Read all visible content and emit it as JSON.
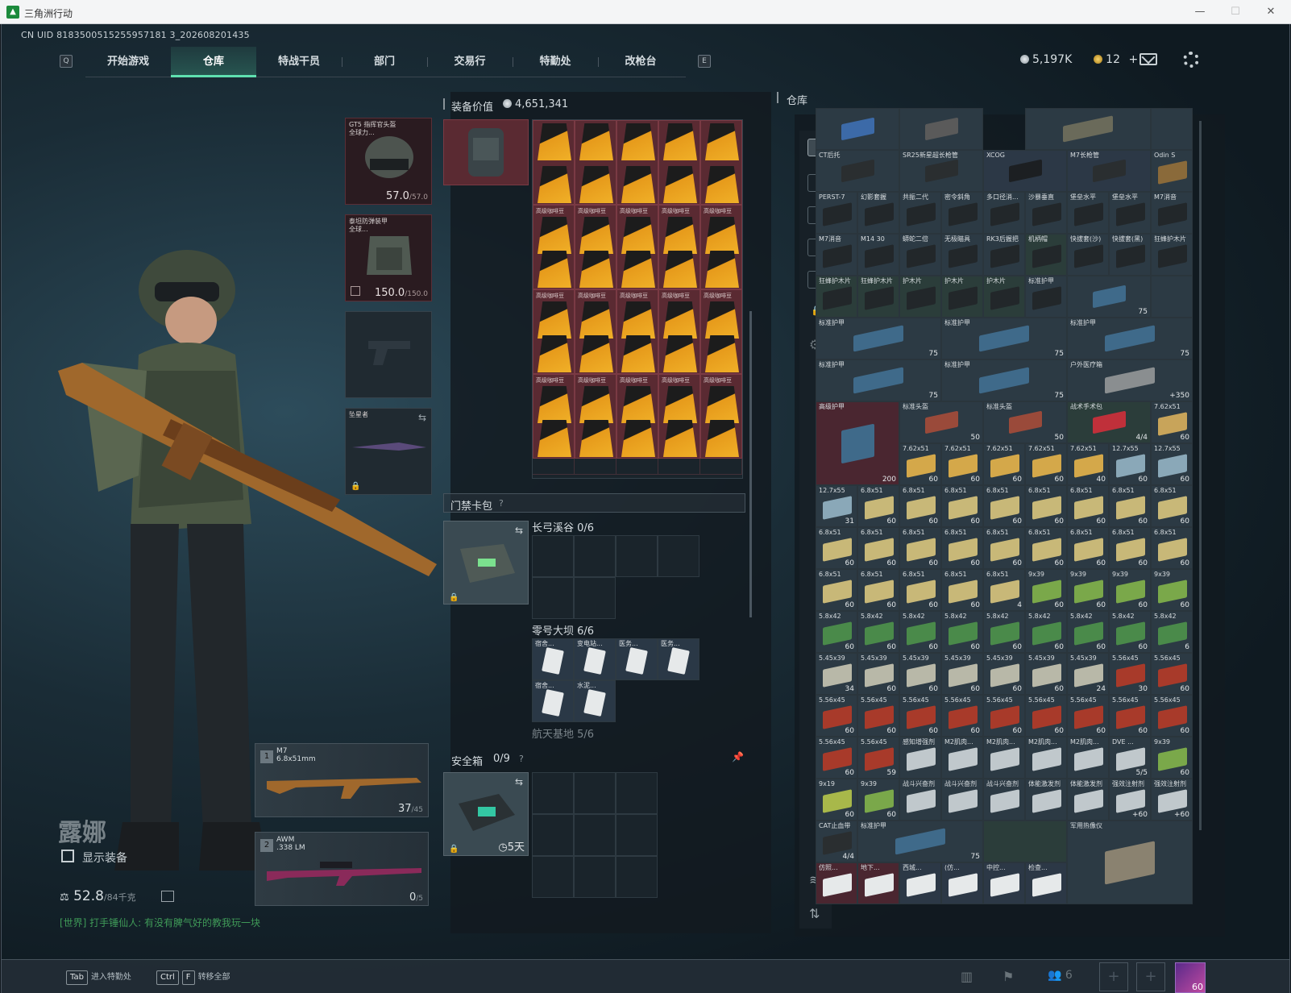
{
  "window": {
    "title": "三角洲行动",
    "minimize": "—",
    "maximize": "☐",
    "close": "✕"
  },
  "uid": "CN UID 8183500515255957181 3_202608201435",
  "nav": {
    "left_key": "Q",
    "right_key": "E",
    "tabs": [
      "开始游戏",
      "仓库",
      "特战干员",
      "部门",
      "交易行",
      "特勤处",
      "改枪台"
    ],
    "active": "仓库"
  },
  "currency": {
    "coins": "5,197K",
    "tickets": "12",
    "plus": "+"
  },
  "operator": {
    "name": "露娜",
    "show_equipment": "显示装备",
    "weight": "52.8",
    "weight_max": "/84千克"
  },
  "chat": {
    "text": "[世界] 打手锤仙人: 有没有脾气好的教我玩一块"
  },
  "equipment": {
    "helmet": {
      "label": "GT5 指挥官头盔",
      "sub": "全球力...",
      "durability": "57.0",
      "max": "/57.0"
    },
    "armor": {
      "label": "泰坦防弹装甲",
      "sub": "全球...",
      "durability": "150.0",
      "max": "/150.0"
    },
    "melee": {
      "label": "坠星者"
    }
  },
  "weapons": [
    {
      "slot": "1",
      "name": "M7",
      "caliber": "6.8x51mm",
      "ammo": "37",
      "ammo_max": "/45"
    },
    {
      "slot": "2",
      "name": "AWM",
      "caliber": ".338 LM",
      "ammo": "0",
      "ammo_max": "/5"
    }
  ],
  "backpack": {
    "title": "装备价值",
    "value": "4,651,341",
    "item_label": "高级咖啡豆",
    "colors": {
      "item_bg": "#5a2a32",
      "coffee": "#f0b028"
    }
  },
  "keycard": {
    "title": "门禁卡包",
    "help": "?",
    "maps": [
      {
        "name": "长弓溪谷",
        "count": "0/6"
      },
      {
        "name": "零号大坝",
        "count": "6/6"
      },
      {
        "name": "航天基地",
        "count": "5/6"
      }
    ],
    "cards": [
      "宿舍...",
      "变电站...",
      "医务...",
      "医务...",
      "宿舍...",
      "水泥..."
    ]
  },
  "safebox": {
    "title": "安全箱",
    "count": "0/9",
    "help": "?",
    "timer": "5天"
  },
  "stash": {
    "title": "仓库",
    "top_items": [
      "",
      "",
      "",
      ""
    ],
    "row1": [
      {
        "l": "CT后托",
        "c": "n"
      },
      {
        "l": "SR25新星超长枪管",
        "c": "n"
      },
      {
        "l": "XCOG",
        "c": "b"
      },
      {
        "l": "M7长枪管",
        "c": "b"
      },
      {
        "l": "Odin S",
        "c": "n"
      }
    ],
    "row2": [
      "PERST-7",
      "幻影套握",
      "共振二代",
      "密令斜角",
      "多口径消...",
      "沙暴垂直",
      "堡垒水平",
      "堡垒水平",
      "M7消音"
    ],
    "row3": [
      "M7消音",
      "M14 30",
      "蟒蛇二倍",
      "无极瞄具",
      "RK3后握把",
      "机柄帽",
      "快拔套(沙)",
      "快拔套(黑)",
      "狂蜂护木片"
    ],
    "row4": [
      "狂蜂护木片",
      "狂蜂护木片",
      "护木片",
      "护木片",
      "护木片",
      "标准护甲"
    ],
    "armor_label": "标准护甲",
    "armor_count": "75",
    "medkit": {
      "label": "户外医疗箱",
      "count": "+350"
    },
    "big_armor": {
      "label": "高级护甲",
      "count": "200"
    },
    "helmet_label": "标准头盔",
    "helmet_count": "50",
    "trauma": {
      "label": "战术手术包",
      "count": "4/4"
    },
    "ammo_rows": [
      [
        {
          "l": "7.62x51",
          "n": "60",
          "c": "#c8a45a"
        }
      ],
      [
        {
          "l": "7.62x51",
          "n": "60"
        },
        {
          "l": "7.62x51",
          "n": "60"
        },
        {
          "l": "7.62x51",
          "n": "60"
        },
        {
          "l": "7.62x51",
          "n": "60"
        },
        {
          "l": "7.62x51",
          "n": "40"
        },
        {
          "l": "12.7x55",
          "n": "60"
        },
        {
          "l": "12.7x55",
          "n": "60"
        }
      ],
      [
        {
          "l": "12.7x55",
          "n": "31"
        },
        {
          "l": "6.8x51",
          "n": "60"
        },
        {
          "l": "6.8x51",
          "n": "60"
        },
        {
          "l": "6.8x51",
          "n": "60"
        },
        {
          "l": "6.8x51",
          "n": "60"
        },
        {
          "l": "6.8x51",
          "n": "60"
        },
        {
          "l": "6.8x51",
          "n": "60"
        },
        {
          "l": "6.8x51",
          "n": "60"
        },
        {
          "l": "6.8x51",
          "n": "60"
        }
      ],
      [
        {
          "l": "6.8x51",
          "n": "60"
        },
        {
          "l": "6.8x51",
          "n": "60"
        },
        {
          "l": "6.8x51",
          "n": "60"
        },
        {
          "l": "6.8x51",
          "n": "60"
        },
        {
          "l": "6.8x51",
          "n": "60"
        },
        {
          "l": "6.8x51",
          "n": "60"
        },
        {
          "l": "6.8x51",
          "n": "60"
        },
        {
          "l": "6.8x51",
          "n": "60"
        },
        {
          "l": "6.8x51",
          "n": "60"
        }
      ],
      [
        {
          "l": "6.8x51",
          "n": "60"
        },
        {
          "l": "6.8x51",
          "n": "60"
        },
        {
          "l": "6.8x51",
          "n": "60"
        },
        {
          "l": "6.8x51",
          "n": "60"
        },
        {
          "l": "6.8x51",
          "n": "4"
        },
        {
          "l": "9x39",
          "n": "60"
        },
        {
          "l": "9x39",
          "n": "60"
        },
        {
          "l": "9x39",
          "n": "60"
        },
        {
          "l": "9x39",
          "n": "60"
        }
      ],
      [
        {
          "l": "5.8x42",
          "n": "60"
        },
        {
          "l": "5.8x42",
          "n": "60"
        },
        {
          "l": "5.8x42",
          "n": "60"
        },
        {
          "l": "5.8x42",
          "n": "60"
        },
        {
          "l": "5.8x42",
          "n": "60"
        },
        {
          "l": "5.8x42",
          "n": "60"
        },
        {
          "l": "5.8x42",
          "n": "60"
        },
        {
          "l": "5.8x42",
          "n": "60"
        },
        {
          "l": "5.8x42",
          "n": "6"
        }
      ],
      [
        {
          "l": "5.45x39",
          "n": "34"
        },
        {
          "l": "5.45x39",
          "n": "60"
        },
        {
          "l": "5.45x39",
          "n": "60"
        },
        {
          "l": "5.45x39",
          "n": "60"
        },
        {
          "l": "5.45x39",
          "n": "60"
        },
        {
          "l": "5.45x39",
          "n": "60"
        },
        {
          "l": "5.45x39",
          "n": "24"
        },
        {
          "l": "5.56x45",
          "n": "30"
        },
        {
          "l": "5.56x45",
          "n": "60"
        }
      ],
      [
        {
          "l": "5.56x45",
          "n": "60"
        },
        {
          "l": "5.56x45",
          "n": "60"
        },
        {
          "l": "5.56x45",
          "n": "60"
        },
        {
          "l": "5.56x45",
          "n": "60"
        },
        {
          "l": "5.56x45",
          "n": "60"
        },
        {
          "l": "5.56x45",
          "n": "60"
        },
        {
          "l": "5.56x45",
          "n": "60"
        },
        {
          "l": "5.56x45",
          "n": "60"
        },
        {
          "l": "5.56x45",
          "n": "60"
        }
      ],
      [
        {
          "l": "5.56x45",
          "n": "60"
        },
        {
          "l": "5.56x45",
          "n": "59"
        },
        {
          "l": "感知增强剂",
          "n": ""
        },
        {
          "l": "M2肌肉...",
          "n": ""
        },
        {
          "l": "M2肌肉...",
          "n": ""
        },
        {
          "l": "M2肌肉...",
          "n": ""
        },
        {
          "l": "M2肌肉...",
          "n": ""
        },
        {
          "l": "DVE ...",
          "n": "5/5"
        },
        {
          "l": "9x39",
          "n": "60"
        }
      ],
      [
        {
          "l": "9x19",
          "n": "60"
        },
        {
          "l": "9x39",
          "n": "60"
        },
        {
          "l": "战斗兴奋剂",
          "n": ""
        },
        {
          "l": "战斗兴奋剂",
          "n": ""
        },
        {
          "l": "战斗兴奋剂",
          "n": ""
        },
        {
          "l": "体能激发剂",
          "n": ""
        },
        {
          "l": "体能激发剂",
          "n": ""
        },
        {
          "l": "强效注射剂",
          "n": "+60"
        },
        {
          "l": "强效注射剂",
          "n": "+60"
        }
      ]
    ],
    "last_row": {
      "tourniquet": "CAT止血带",
      "tourniquet_count": "4/4",
      "armor": "标准护甲",
      "armor_count": "75",
      "thermal": "军用热像仪"
    },
    "bottom_row": [
      "仿照...",
      "地下...",
      "西城...",
      "(仿...",
      "中控...",
      "检查..."
    ]
  },
  "bottom": {
    "tab_key": "Tab",
    "tab_label": "进入特勤处",
    "ctrl_key": "Ctrl",
    "f_key": "F",
    "ctrl_label": "转移全部",
    "friends": "6",
    "level": "60"
  }
}
